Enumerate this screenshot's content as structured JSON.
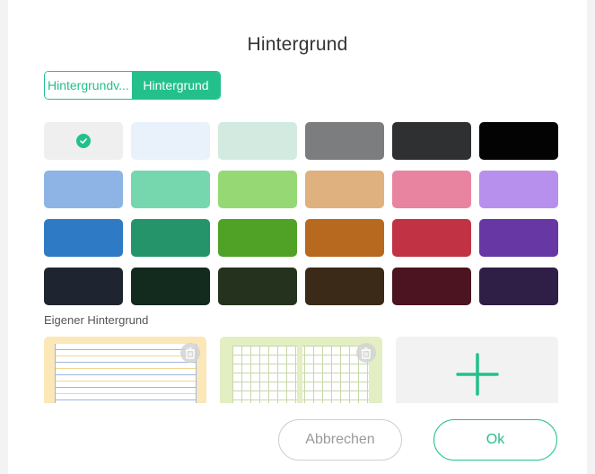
{
  "dialog": {
    "title": "Hintergrund"
  },
  "tabs": [
    {
      "label": "Hintergrundv...",
      "active": false
    },
    {
      "label": "Hintergrund",
      "active": true
    }
  ],
  "colors": {
    "accent": "#23c08b"
  },
  "swatches": [
    {
      "color": "#efefef",
      "selected": true
    },
    {
      "color": "#e9f2fb",
      "selected": false
    },
    {
      "color": "#d2eadf",
      "selected": false
    },
    {
      "color": "#7b7d7f",
      "selected": false
    },
    {
      "color": "#2f3032",
      "selected": false
    },
    {
      "color": "#030303",
      "selected": false
    },
    {
      "color": "#8db4e4",
      "selected": false
    },
    {
      "color": "#76d7ae",
      "selected": false
    },
    {
      "color": "#96d974",
      "selected": false
    },
    {
      "color": "#dfb17f",
      "selected": false
    },
    {
      "color": "#e8849f",
      "selected": false
    },
    {
      "color": "#b690ec",
      "selected": false
    },
    {
      "color": "#2f7ac4",
      "selected": false
    },
    {
      "color": "#26946a",
      "selected": false
    },
    {
      "color": "#4fa225",
      "selected": false
    },
    {
      "color": "#b6691f",
      "selected": false
    },
    {
      "color": "#c13244",
      "selected": false
    },
    {
      "color": "#6737a3",
      "selected": false
    },
    {
      "color": "#1f2530",
      "selected": false
    },
    {
      "color": "#132a1f",
      "selected": false
    },
    {
      "color": "#25331e",
      "selected": false
    },
    {
      "color": "#3b2a17",
      "selected": false
    },
    {
      "color": "#4b1420",
      "selected": false
    },
    {
      "color": "#2f1e45",
      "selected": false
    }
  ],
  "custom_section": {
    "label": "Eigener Hintergrund",
    "items": [
      {
        "kind": "lined-paper",
        "icon": "trash-icon"
      },
      {
        "kind": "grid-paper",
        "icon": "trash-icon"
      },
      {
        "kind": "add",
        "icon": "plus-icon"
      }
    ]
  },
  "buttons": {
    "cancel": "Abbrechen",
    "ok": "Ok"
  }
}
